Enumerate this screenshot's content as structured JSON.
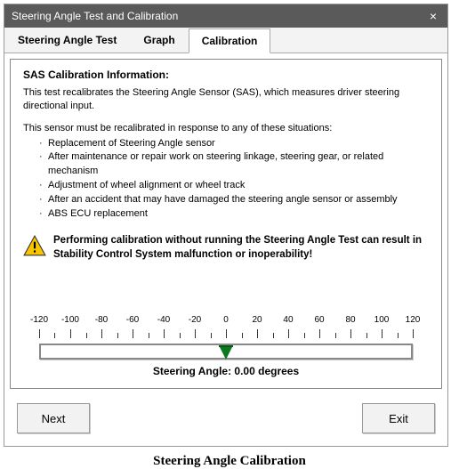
{
  "window": {
    "title": "Steering Angle Test and Calibration"
  },
  "tabs": [
    {
      "label": "Steering Angle Test"
    },
    {
      "label": "Graph"
    },
    {
      "label": "Calibration"
    }
  ],
  "active_tab_index": 2,
  "info": {
    "heading": "SAS Calibration Information:",
    "intro": "This test recalibrates the Steering Angle Sensor (SAS), which measures driver steering directional input.",
    "situations_lead": "This sensor must be recalibrated in response to any of these situations:",
    "situations": [
      "Replacement of Steering Angle sensor",
      "After maintenance or repair work on steering linkage, steering gear, or related mechanism",
      "Adjustment of wheel alignment or wheel track",
      "After an accident that may have damaged the steering angle sensor or assembly",
      "ABS ECU replacement"
    ],
    "warning": "Performing calibration without running the Steering Angle Test can result in Stability Control System malfunction or inoperability!"
  },
  "gauge": {
    "ticks": [
      -120,
      -100,
      -80,
      -60,
      -40,
      -20,
      0,
      20,
      40,
      60,
      80,
      100,
      120
    ],
    "readout_label": "Steering Angle:",
    "value_text": "0.00 degrees"
  },
  "buttons": {
    "next": "Next",
    "exit": "Exit"
  },
  "caption": "Steering Angle Calibration"
}
